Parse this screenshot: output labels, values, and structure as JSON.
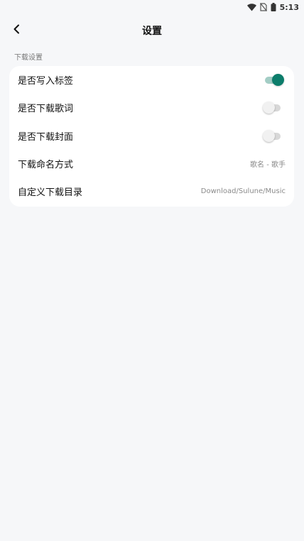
{
  "status_bar": {
    "time": "5:13",
    "icons": [
      "wifi-icon",
      "no-sim-icon",
      "battery-icon"
    ]
  },
  "header": {
    "title": "设置",
    "back_icon": "chevron-left-icon"
  },
  "section": {
    "title": "下载设置"
  },
  "settings": [
    {
      "label": "是否写入标签",
      "type": "toggle",
      "on": true
    },
    {
      "label": "是否下载歌词",
      "type": "toggle",
      "on": false
    },
    {
      "label": "是否下载封面",
      "type": "toggle",
      "on": false
    },
    {
      "label": "下载命名方式",
      "type": "value",
      "value": "歌名 - 歌手"
    },
    {
      "label": "自定义下载目录",
      "type": "value",
      "value": "Download/Sulune/Music"
    }
  ],
  "colors": {
    "accent": "#0c7d6b",
    "accent_track": "#a3cdc5",
    "background": "#f6f7f9",
    "card": "#ffffff"
  }
}
